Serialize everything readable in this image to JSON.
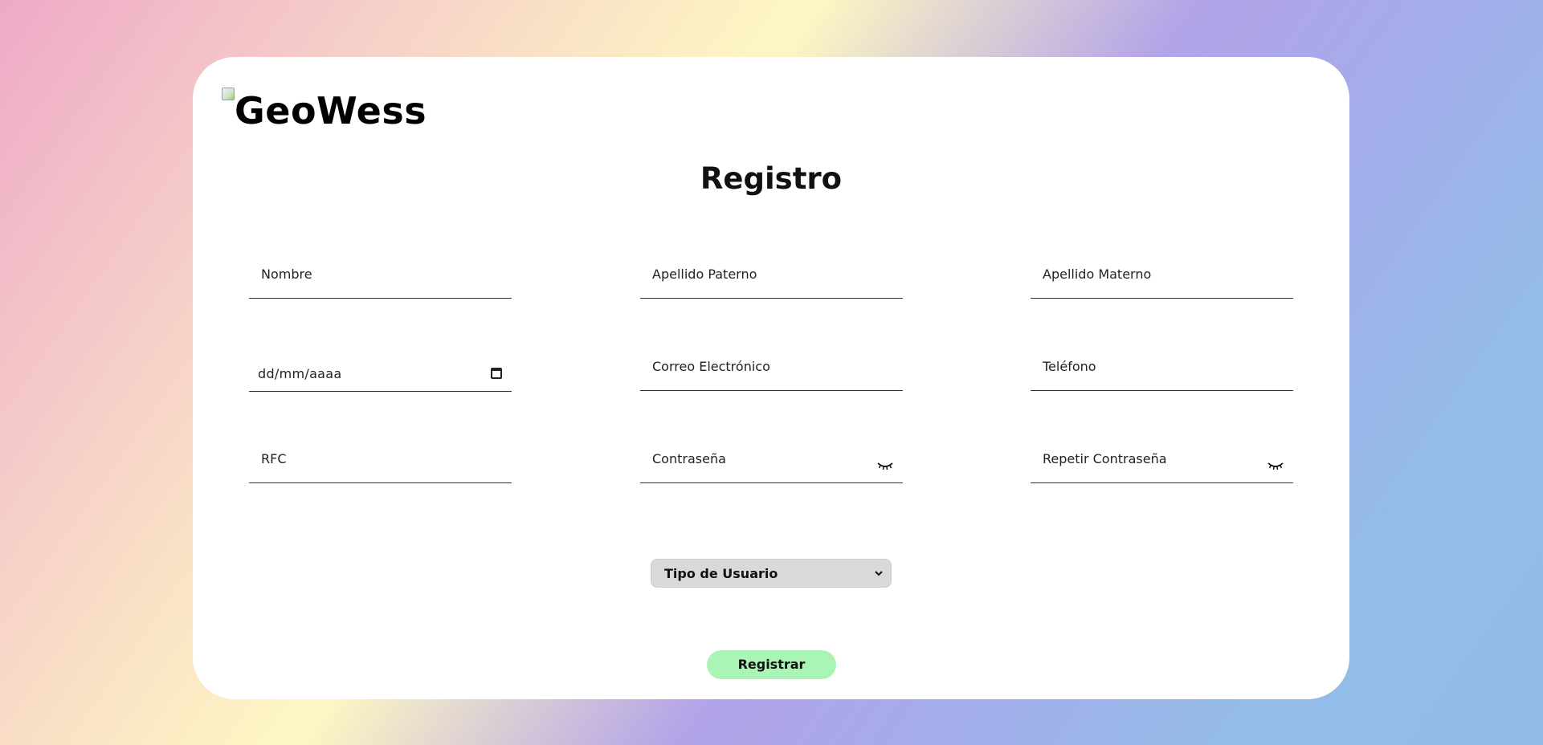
{
  "logo": {
    "text": "GeoWess"
  },
  "page_title": "Registro",
  "fields": {
    "nombre": "Nombre",
    "apellido_paterno": "Apellido Paterno",
    "apellido_materno": "Apellido Materno",
    "fecha": "dd/mm/aaaa",
    "correo": "Correo Electrónico",
    "telefono": "Teléfono",
    "rfc": "RFC",
    "contrasena": "Contraseña",
    "repetir_contrasena": "Repetir Contraseña"
  },
  "tipo_usuario": {
    "selected": "Tipo de Usuario"
  },
  "submit_label": "Registrar",
  "colors": {
    "button_bg": "#a9f5b5",
    "select_bg": "#d9d9d9",
    "card_bg": "#ffffff"
  },
  "icons": [
    "broken-image-icon",
    "calendar-icon",
    "eye-closed-icon",
    "chevron-down-icon"
  ]
}
